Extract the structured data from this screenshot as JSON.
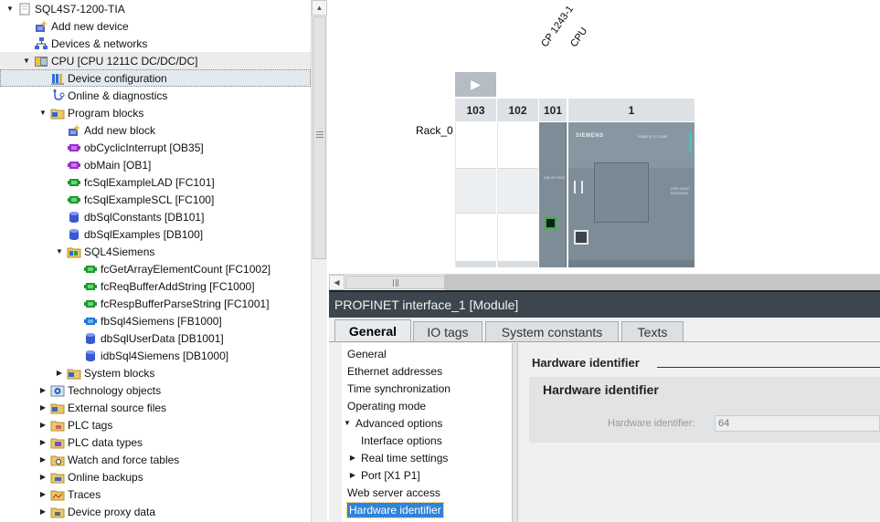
{
  "tree": {
    "items": [
      {
        "label": "SQL4S7-1200-TIA",
        "icon": "project-icon",
        "expander": "expanded",
        "indent": 0
      },
      {
        "label": "Add new device",
        "icon": "add-device-icon",
        "expander": "none",
        "indent": 1
      },
      {
        "label": "Devices & networks",
        "icon": "network-icon",
        "expander": "none",
        "indent": 1
      },
      {
        "label": "CPU [CPU 1211C DC/DC/DC]",
        "icon": "plc-icon",
        "expander": "expanded",
        "indent": 1
      },
      {
        "label": "Device configuration",
        "icon": "device-config-icon",
        "expander": "none",
        "indent": 2
      },
      {
        "label": "Online & diagnostics",
        "icon": "diagnostics-icon",
        "expander": "none",
        "indent": 2
      },
      {
        "label": "Program blocks",
        "icon": "folder-icon",
        "expander": "expanded",
        "indent": 2
      },
      {
        "label": "Add new block",
        "icon": "add-block-icon",
        "expander": "none",
        "indent": 3
      },
      {
        "label": "obCyclicInterrupt [OB35]",
        "icon": "ob-block-icon",
        "expander": "none",
        "indent": 3
      },
      {
        "label": "obMain [OB1]",
        "icon": "ob-block-icon",
        "expander": "none",
        "indent": 3
      },
      {
        "label": "fcSqlExampleLAD [FC101]",
        "icon": "fc-block-icon",
        "expander": "none",
        "indent": 3
      },
      {
        "label": "fcSqlExampleSCL [FC100]",
        "icon": "fc-block-icon",
        "expander": "none",
        "indent": 3
      },
      {
        "label": "dbSqlConstants [DB101]",
        "icon": "db-block-icon",
        "expander": "none",
        "indent": 3
      },
      {
        "label": "dbSqlExamples [DB100]",
        "icon": "db-block-icon",
        "expander": "none",
        "indent": 3
      },
      {
        "label": "SQL4Siemens",
        "icon": "group-folder-icon",
        "expander": "expanded",
        "indent": 3
      },
      {
        "label": "fcGetArrayElementCount [FC1002]",
        "icon": "fc-block-icon",
        "expander": "none",
        "indent": 4
      },
      {
        "label": "fcReqBufferAddString [FC1000]",
        "icon": "fc-block-icon",
        "expander": "none",
        "indent": 4
      },
      {
        "label": "fcRespBufferParseString [FC1001]",
        "icon": "fc-block-icon",
        "expander": "none",
        "indent": 4
      },
      {
        "label": "fbSql4Siemens [FB1000]",
        "icon": "fb-block-icon",
        "expander": "none",
        "indent": 4
      },
      {
        "label": "dbSqlUserData [DB1001]",
        "icon": "db-block-icon",
        "expander": "none",
        "indent": 4
      },
      {
        "label": "idbSql4Siemens [DB1000]",
        "icon": "db-block-icon",
        "expander": "none",
        "indent": 4
      },
      {
        "label": "System blocks",
        "icon": "folder-icon",
        "expander": "collapsed",
        "indent": 3
      },
      {
        "label": "Technology objects",
        "icon": "technology-icon",
        "expander": "collapsed",
        "indent": 2
      },
      {
        "label": "External source files",
        "icon": "folder-icon",
        "expander": "collapsed",
        "indent": 2
      },
      {
        "label": "PLC tags",
        "icon": "tags-icon",
        "expander": "collapsed",
        "indent": 2
      },
      {
        "label": "PLC data types",
        "icon": "data-types-icon",
        "expander": "collapsed",
        "indent": 2
      },
      {
        "label": "Watch and force tables",
        "icon": "watch-table-icon",
        "expander": "collapsed",
        "indent": 2
      },
      {
        "label": "Online backups",
        "icon": "backup-icon",
        "expander": "collapsed",
        "indent": 2
      },
      {
        "label": "Traces",
        "icon": "traces-icon",
        "expander": "collapsed",
        "indent": 2
      },
      {
        "label": "Device proxy data",
        "icon": "proxy-icon",
        "expander": "collapsed",
        "indent": 2
      }
    ],
    "selected_index": 4
  },
  "device_view": {
    "module_names": [
      "CP 1243-1",
      "CPU"
    ],
    "rack_label": "Rack_0",
    "slots": [
      "103",
      "102",
      "101",
      "1"
    ],
    "cpu_brand": "SIEMENS",
    "cpu_model": "SIMATIC S7-1200",
    "cpu_variant": "CPU 1211C DC/DC/DC",
    "cp_module_text": "CM CP 1243",
    "accent_color": "#2fb53c"
  },
  "inspector": {
    "title": "PROFINET interface_1 [Module]",
    "tabs": [
      "General",
      "IO tags",
      "System constants",
      "Texts"
    ],
    "active_tab": "General",
    "nav": [
      {
        "label": "General",
        "arrow": "none",
        "indent": 0
      },
      {
        "label": "Ethernet addresses",
        "arrow": "none",
        "indent": 0
      },
      {
        "label": "Time synchronization",
        "arrow": "none",
        "indent": 0
      },
      {
        "label": "Operating mode",
        "arrow": "none",
        "indent": 0
      },
      {
        "label": "Advanced options",
        "arrow": "expanded",
        "indent": 0
      },
      {
        "label": "Interface options",
        "arrow": "none",
        "indent": 1
      },
      {
        "label": "Real time settings",
        "arrow": "collapsed",
        "indent": 1
      },
      {
        "label": "Port [X1 P1]",
        "arrow": "collapsed",
        "indent": 1
      },
      {
        "label": "Web server access",
        "arrow": "none",
        "indent": 0
      },
      {
        "label": "Hardware identifier",
        "arrow": "none",
        "indent": 0
      }
    ],
    "selected_nav": "Hardware identifier",
    "section_title": "Hardware identifier",
    "box_title": "Hardware identifier",
    "field_label": "Hardware identifier:",
    "field_value": "64"
  }
}
